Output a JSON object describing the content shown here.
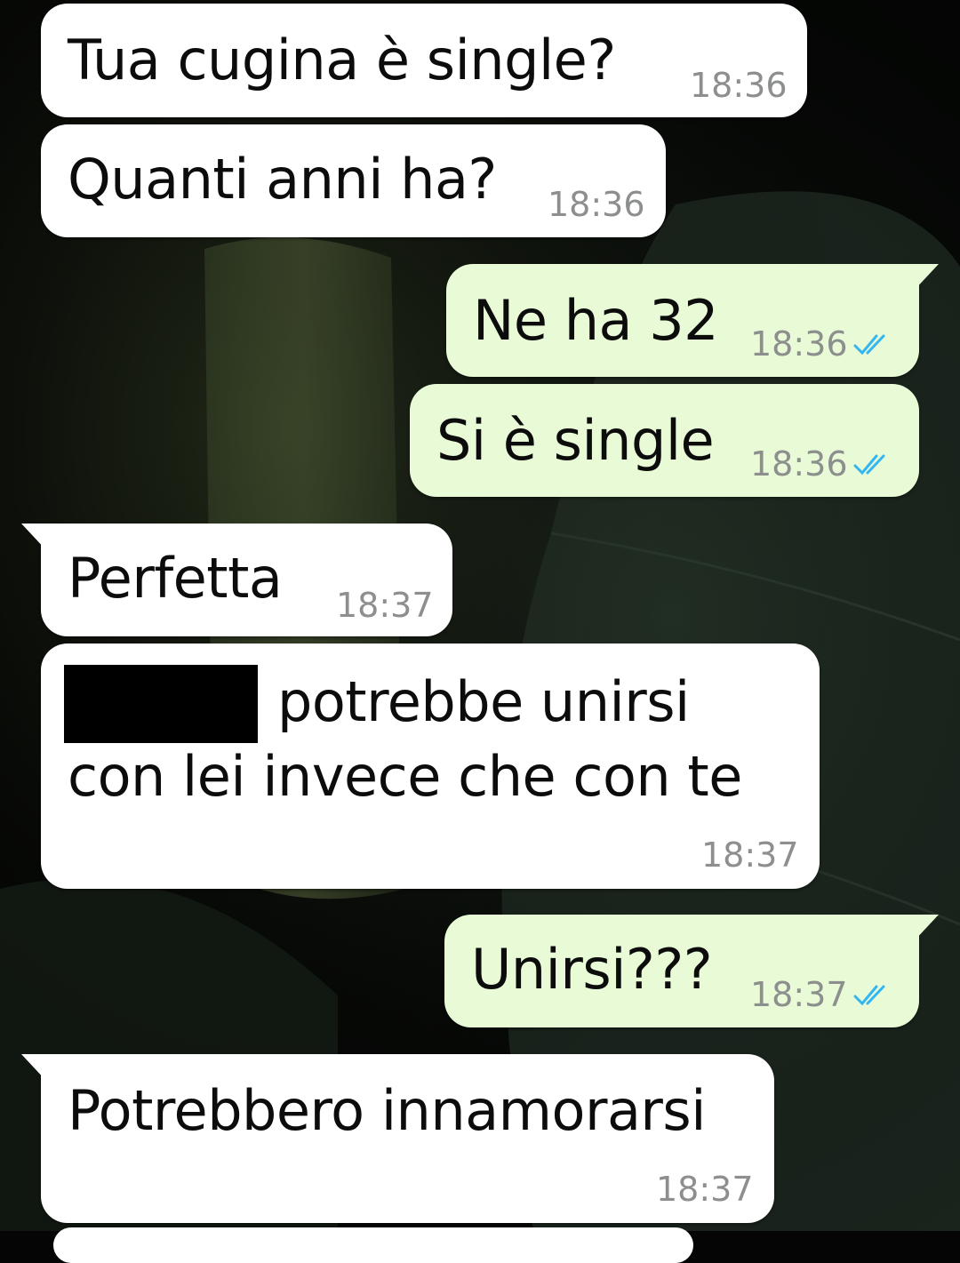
{
  "messages": [
    {
      "direction": "incoming",
      "text": "Tua cugina è single?",
      "time": "18:36"
    },
    {
      "direction": "incoming",
      "text": "Quanti anni ha?",
      "time": "18:36"
    },
    {
      "direction": "outgoing",
      "text": "Ne ha 32",
      "time": "18:36",
      "status_icon": "double-check-read-icon"
    },
    {
      "direction": "outgoing",
      "text": "Si è single",
      "time": "18:36",
      "status_icon": "double-check-read-icon"
    },
    {
      "direction": "incoming",
      "text": "Perfetta",
      "time": "18:37"
    },
    {
      "direction": "incoming",
      "line1_after_redaction": "potrebbe unirsi",
      "line2": "con lei invece che con te",
      "time": "18:37",
      "redacted_name": true
    },
    {
      "direction": "outgoing",
      "text": "Unirsi???",
      "time": "18:37",
      "status_icon": "double-check-read-icon"
    },
    {
      "direction": "incoming",
      "text": "Potrebbero innamorarsi",
      "time": "18:37"
    }
  ],
  "colors": {
    "incoming_bubble": "#ffffff",
    "outgoing_bubble": "#e8fbd6",
    "read_ticks": "#34b7f1",
    "timestamp": "#8c8f8e",
    "wallpaper": "#040504"
  }
}
